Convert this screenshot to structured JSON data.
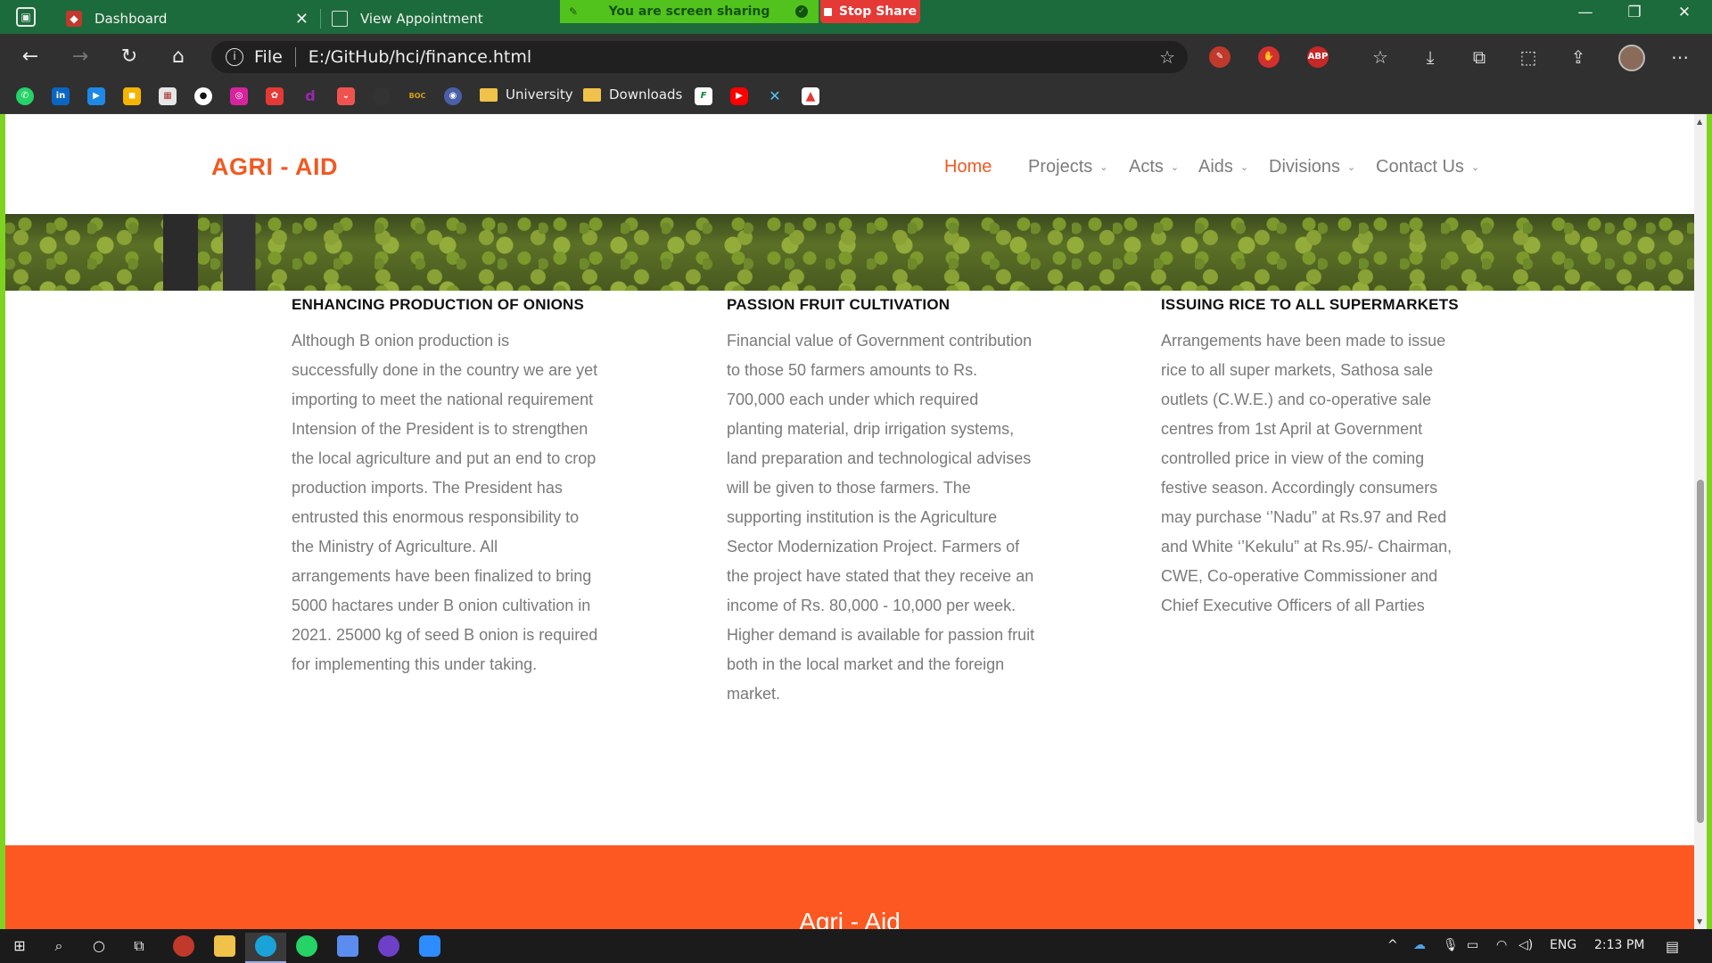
{
  "browser": {
    "tabs": [
      {
        "title": "Dashboard"
      },
      {
        "title": "View Appointment"
      }
    ],
    "screen_share": {
      "banner": "You are screen sharing",
      "stop": "Stop Share"
    },
    "address": {
      "scheme": "File",
      "url": "E:/GitHub/hci/finance.html"
    },
    "extensions": [
      {
        "name": "ABP",
        "label": "ABP"
      }
    ],
    "bookmarks": [
      {
        "type": "folder",
        "label": "University"
      },
      {
        "type": "folder",
        "label": "Downloads"
      }
    ]
  },
  "site": {
    "logo": "AGRI - AID",
    "nav": [
      {
        "label": "Home",
        "active": true
      },
      {
        "label": "Projects"
      },
      {
        "label": "Acts"
      },
      {
        "label": "Aids"
      },
      {
        "label": "Divisions"
      },
      {
        "label": "Contact Us"
      }
    ],
    "articles": [
      {
        "title": "ENHANCING PRODUCTION OF ONIONS",
        "lines": [
          "Although B onion production is",
          "successfully done in the country we are yet",
          "importing to meet the national requirement",
          "Intension of the President is to strengthen",
          "the local agriculture and put an end to crop",
          "production imports. The President has",
          "entrusted this enormous responsibility to",
          "the Ministry of Agriculture. All",
          "arrangements have been finalized to bring",
          "5000 hactares under B onion cultivation in",
          "2021. 25000 kg of seed B onion is required",
          "for implementing this under taking."
        ]
      },
      {
        "title": "PASSION FRUIT CULTIVATION",
        "lines": [
          "Financial value of Government contribution",
          "to those 50 farmers amounts to Rs.",
          "700,000 each under which required",
          "planting material, drip irrigation systems,",
          "land preparation and technological advises",
          "will be given to those farmers. The",
          "supporting institution is the Agriculture",
          "Sector Modernization Project. Farmers of",
          "the project have stated that they receive an",
          "income of Rs. 80,000 - 10,000 per week.",
          "Higher demand is available for passion fruit",
          "both in the local market and the foreign",
          "market."
        ]
      },
      {
        "title": "ISSUING RICE TO ALL SUPERMARKETS",
        "lines": [
          "Arrangements have been made to issue",
          "rice to all super markets, Sathosa sale",
          "outlets (C.W.E.) and co-operative sale",
          "centres from 1st April at Government",
          "controlled price in view of the coming",
          "festive season. Accordingly consumers",
          "may purchase ‘’Nadu” at Rs.97 and Red",
          "and White ‘’Kekulu” at Rs.95/- Chairman,",
          "CWE, Co-operative Commissioner and",
          "Chief Executive Officers of all Parties"
        ]
      }
    ],
    "footer_title": "Agri - Aid"
  },
  "taskbar": {
    "language": "ENG",
    "time": "2:13 PM"
  },
  "colors": {
    "accent": "#f05a22",
    "footer": "#fd5821",
    "frame": "#7ed321"
  }
}
